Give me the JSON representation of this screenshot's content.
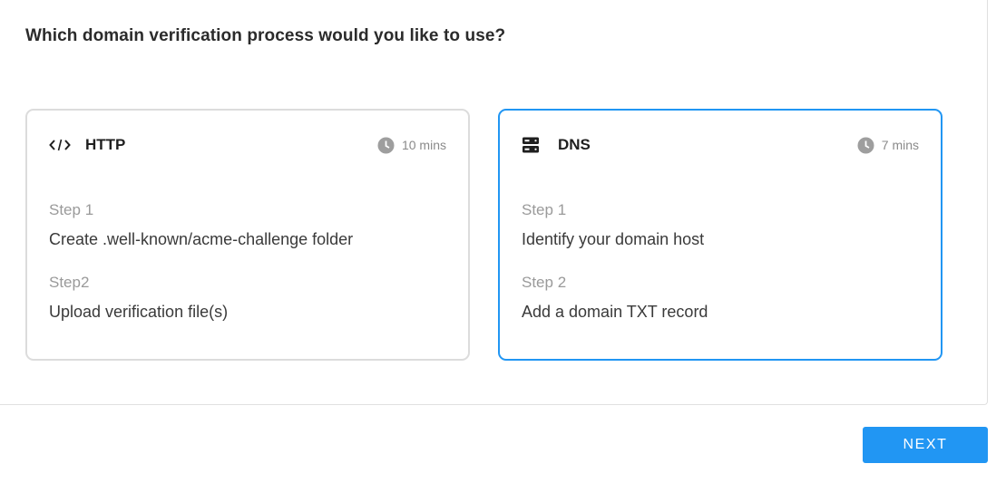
{
  "question": "Which domain verification process would you like to use?",
  "options": [
    {
      "title": "HTTP",
      "icon": "code-icon",
      "duration": "10 mins",
      "selected": false,
      "steps": [
        {
          "label": "Step 1",
          "text": "Create .well-known/acme-challenge folder"
        },
        {
          "label": "Step2",
          "text": "Upload verification file(s)"
        }
      ]
    },
    {
      "title": "DNS",
      "icon": "server-icon",
      "duration": "7 mins",
      "selected": true,
      "steps": [
        {
          "label": "Step 1",
          "text": "Identify your domain host"
        },
        {
          "label": "Step 2",
          "text": "Add a domain TXT record"
        }
      ]
    }
  ],
  "next_label": "NEXT",
  "colors": {
    "accent": "#2196f3",
    "card_border": "#dcdcdc",
    "muted_text": "#9a9a9a"
  }
}
